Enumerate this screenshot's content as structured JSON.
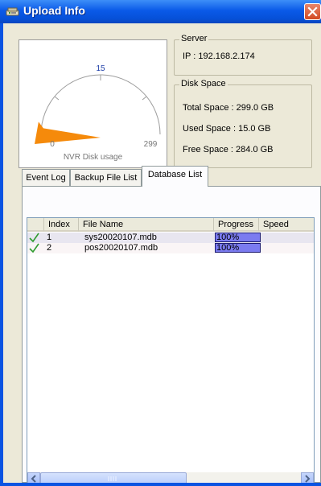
{
  "window": {
    "title": "Upload Info",
    "icons": {
      "app": "network-upload-icon",
      "close": "close-icon"
    }
  },
  "gauge": {
    "label": "NVR Disk usage",
    "min_label": "0",
    "max_label": "299",
    "mid_label": "15",
    "used_fraction": 0.05,
    "fill_color": "#f58a0b"
  },
  "server": {
    "title": "Server",
    "ip_line": "IP : 192.168.2.174"
  },
  "disk_space": {
    "title": "Disk Space",
    "total_line": "Total Space : 299.0 GB",
    "used_line": "Used Space : 15.0 GB",
    "free_line": "Free Space : 284.0 GB"
  },
  "tabs": [
    {
      "label": "Event Log",
      "active": false
    },
    {
      "label": "Backup File List",
      "active": false
    },
    {
      "label": "Database List",
      "active": true
    }
  ],
  "table": {
    "columns": [
      "",
      "Index",
      "File Name",
      "Progress",
      "Speed"
    ],
    "rows": [
      {
        "index": "1",
        "file_name": "sys20020107.mdb",
        "progress": "100%",
        "progress_value": 1.0,
        "speed": "",
        "status_icon": "checkmark-icon"
      },
      {
        "index": "2",
        "file_name": "pos20020107.mdb",
        "progress": "100%",
        "progress_value": 1.0,
        "speed": "",
        "status_icon": "checkmark-icon"
      }
    ]
  },
  "colors": {
    "titlebar": "#0a54e2",
    "dialog_bg": "#ece9d8",
    "progress_fill": "#7b7bf0",
    "check": "#2f9c2f"
  }
}
